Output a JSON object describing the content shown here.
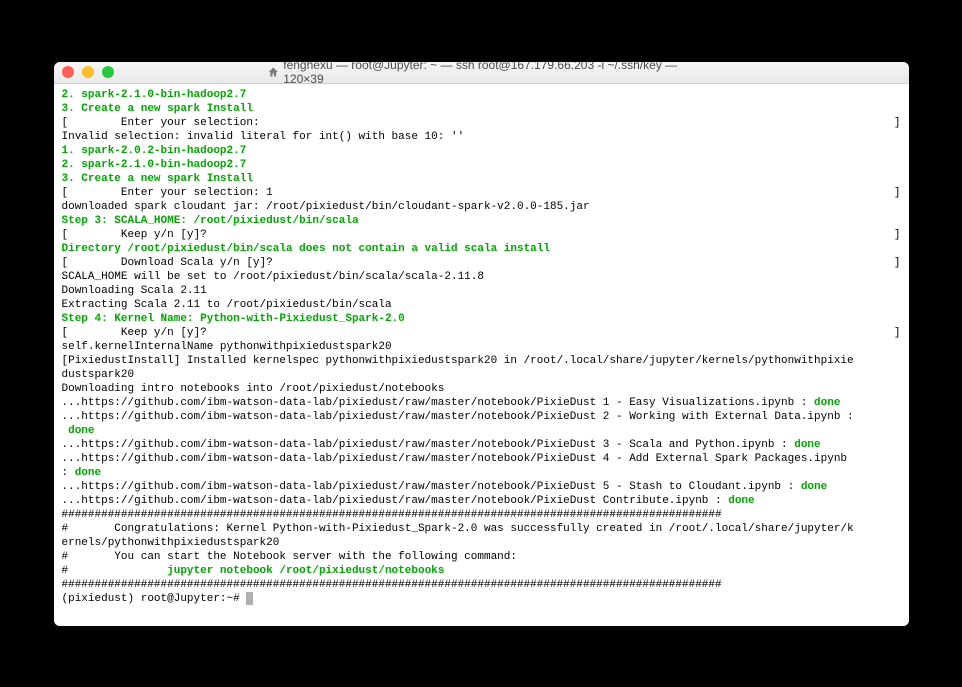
{
  "window": {
    "title": "fenghexu — root@Jupyter: ~ — ssh root@167.179.66.203 -i ~/.ssh/key — 120×39"
  },
  "term": {
    "l01": "2. spark-2.1.0-bin-hadoop2.7",
    "l02": "3. Create a new spark Install",
    "l03a": "[",
    "l03b": "        Enter your selection:",
    "l03c": "]",
    "l04": "Invalid selection: invalid literal for int() with base 10: ''",
    "l05": "1. spark-2.0.2-bin-hadoop2.7",
    "l06": "2. spark-2.1.0-bin-hadoop2.7",
    "l07": "3. Create a new spark Install",
    "l08a": "[",
    "l08b": "        Enter your selection: 1",
    "l08c": "]",
    "l09": "downloaded spark cloudant jar: /root/pixiedust/bin/cloudant-spark-v2.0.0-185.jar",
    "l10": "Step 3: SCALA_HOME: /root/pixiedust/bin/scala",
    "l11a": "[",
    "l11b": "        Keep y/n [y]?",
    "l11c": "]",
    "l12": "Directory /root/pixiedust/bin/scala does not contain a valid scala install",
    "l13a": "[",
    "l13b": "        Download Scala y/n [y]?",
    "l13c": "]",
    "l14": "SCALA_HOME will be set to /root/pixiedust/bin/scala/scala-2.11.8",
    "l15": "Downloading Scala 2.11",
    "l16": "Extracting Scala 2.11 to /root/pixiedust/bin/scala",
    "l17": "Step 4: Kernel Name: Python-with-Pixiedust_Spark-2.0",
    "l18a": "[",
    "l18b": "        Keep y/n [y]?",
    "l18c": "]",
    "l19": "self.kernelInternalName pythonwithpixiedustspark20",
    "l20": "[PixiedustInstall] Installed kernelspec pythonwithpixiedustspark20 in /root/.local/share/jupyter/kernels/pythonwithpixie",
    "l21": "dustspark20",
    "l22": "Downloading intro notebooks into /root/pixiedust/notebooks",
    "l23a": "...https://github.com/ibm-watson-data-lab/pixiedust/raw/master/notebook/PixieDust 1 - Easy Visualizations.ipynb : ",
    "l23b": "done",
    "l24a": "...https://github.com/ibm-watson-data-lab/pixiedust/raw/master/notebook/PixieDust 2 - Working with External Data.ipynb :",
    "l25a": " ",
    "l25b": "done",
    "l26a": "...https://github.com/ibm-watson-data-lab/pixiedust/raw/master/notebook/PixieDust 3 - Scala and Python.ipynb : ",
    "l26b": "done",
    "l27a": "...https://github.com/ibm-watson-data-lab/pixiedust/raw/master/notebook/PixieDust 4 - Add External Spark Packages.ipynb ",
    "l28a": ": ",
    "l28b": "done",
    "l29a": "...https://github.com/ibm-watson-data-lab/pixiedust/raw/master/notebook/PixieDust 5 - Stash to Cloudant.ipynb : ",
    "l29b": "done",
    "l30a": "...https://github.com/ibm-watson-data-lab/pixiedust/raw/master/notebook/PixieDust Contribute.ipynb : ",
    "l30b": "done",
    "blank": "",
    "l31": "####################################################################################################",
    "l32": "#       Congratulations: Kernel Python-with-Pixiedust_Spark-2.0 was successfully created in /root/.local/share/jupyter/k",
    "l33": "ernels/pythonwithpixiedustspark20",
    "l34": "#       You can start the Notebook server with the following command:",
    "l35a": "#               ",
    "l35b": "jupyter notebook /root/pixiedust/notebooks",
    "l36": "####################################################################################################",
    "l37": "(pixiedust) root@Jupyter:~# "
  }
}
